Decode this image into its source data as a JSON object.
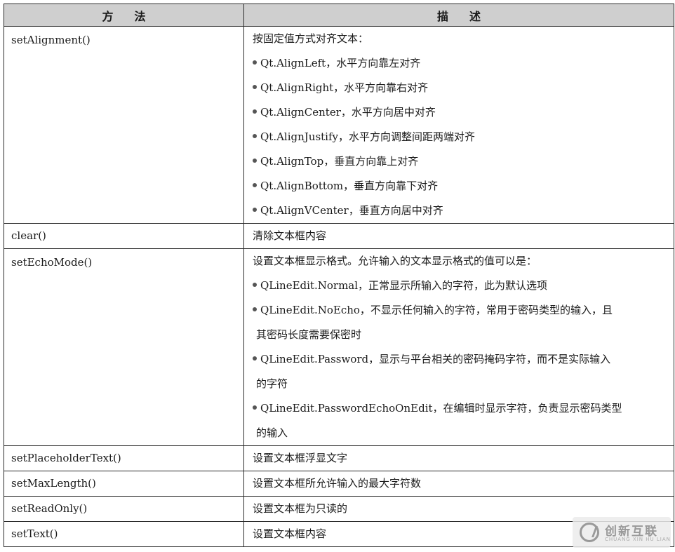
{
  "header": {
    "method": "方法",
    "description": "描述"
  },
  "rows": [
    {
      "method": "setAlignment()",
      "intro": "按固定值方式对齐文本：",
      "bullets": [
        "Qt.AlignLeft，水平方向靠左对齐",
        "Qt.AlignRight，水平方向靠右对齐",
        "Qt.AlignCenter，水平方向居中对齐",
        "Qt.AlignJustify，水平方向调整间距两端对齐",
        "Qt.AlignTop，垂直方向靠上对齐",
        "Qt.AlignBottom，垂直方向靠下对齐",
        "Qt.AlignVCenter，垂直方向居中对齐"
      ]
    },
    {
      "method": "clear()",
      "desc": "清除文本框内容"
    },
    {
      "method": "setEchoMode()",
      "intro": "设置文本框显示格式。允许输入的文本显示格式的值可以是：",
      "bullets": [
        {
          "l1": "QLineEdit.Normal，正常显示所输入的字符，此为默认选项"
        },
        {
          "l1": "QLineEdit.NoEcho，不显示任何输入的字符，常用于密码类型的输入，且",
          "l2": "其密码长度需要保密时"
        },
        {
          "l1": "QLineEdit.Password，显示与平台相关的密码掩码字符，而不是实际输入",
          "l2": "的字符"
        },
        {
          "l1": "QLineEdit.PasswordEchoOnEdit，在编辑时显示字符，负责显示密码类型",
          "l2": "的输入"
        }
      ]
    },
    {
      "method": "setPlaceholderText()",
      "desc": "设置文本框浮显文字"
    },
    {
      "method": "setMaxLength()",
      "desc": "设置文本框所允许输入的最大字符数"
    },
    {
      "method": "setReadOnly()",
      "desc": "设置文本框为只读的"
    },
    {
      "method": "setText()",
      "desc": "设置文本框内容"
    }
  ],
  "watermark": {
    "brand": "创新互联",
    "sub": "CHUANG XIN HU LIAN",
    "logo_icon": "chuangxin-logo-icon"
  }
}
